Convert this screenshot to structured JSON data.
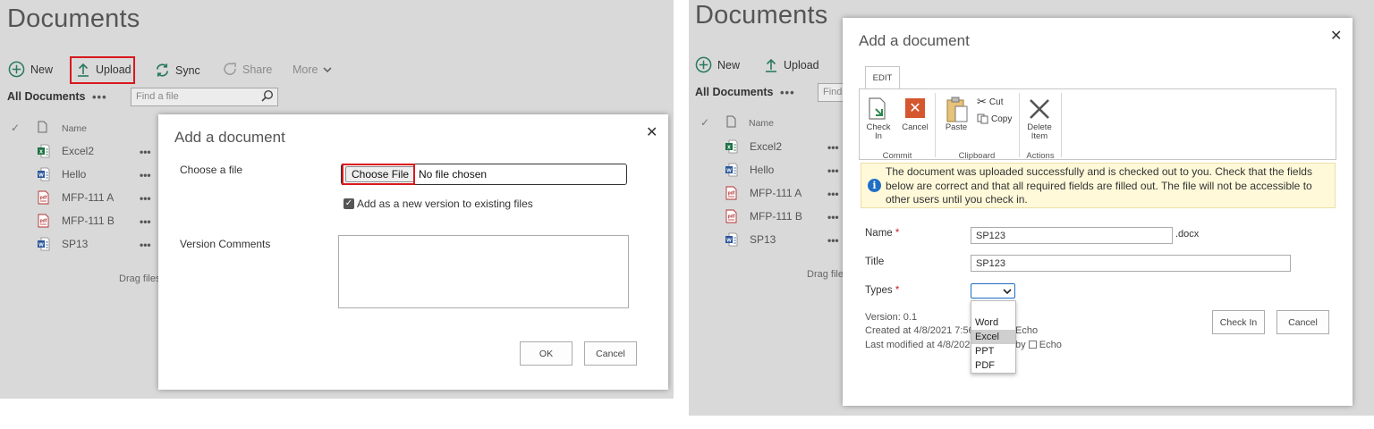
{
  "left": {
    "page_title": "Documents",
    "commands": {
      "new": "New",
      "upload": "Upload",
      "sync": "Sync",
      "share": "Share",
      "more": "More"
    },
    "view_name": "All Documents",
    "view_more": "•••",
    "search_placeholder": "Find a file",
    "column_name": "Name",
    "files": [
      {
        "name": "Excel2",
        "type": "excel"
      },
      {
        "name": "Hello",
        "type": "word"
      },
      {
        "name": "MFP-111 A",
        "type": "pdf"
      },
      {
        "name": "MFP-111 B",
        "type": "pdf"
      },
      {
        "name": "SP13",
        "type": "word"
      }
    ],
    "row_more": "•••",
    "drag_hint": "Drag files",
    "modal": {
      "title": "Add a document",
      "close": "✕",
      "choose_label": "Choose a file",
      "choose_button": "Choose File",
      "no_file": "No file chosen",
      "version_checkbox": "Add as a new version to existing files",
      "version_checked": true,
      "comments_label": "Version Comments",
      "ok": "OK",
      "cancel": "Cancel"
    }
  },
  "right": {
    "page_title": "Documents",
    "commands": {
      "new": "New",
      "upload": "Upload"
    },
    "view_name": "All Documents",
    "view_more": "•••",
    "search_placeholder": "Find",
    "column_name": "Name",
    "files": [
      {
        "name": "Excel2",
        "type": "excel"
      },
      {
        "name": "Hello",
        "type": "word"
      },
      {
        "name": "MFP-111 A",
        "type": "pdf"
      },
      {
        "name": "MFP-111 B",
        "type": "pdf"
      },
      {
        "name": "SP13",
        "type": "word"
      }
    ],
    "row_more": "•••",
    "drag_hint": "Drag file",
    "modal": {
      "title": "Add a document",
      "close": "✕",
      "ribbon_tab": "EDIT",
      "ribbon": {
        "check_in": "Check In",
        "cancel": "Cancel",
        "paste": "Paste",
        "cut": "Cut",
        "copy": "Copy",
        "delete_item": "Delete Item",
        "group_commit": "Commit",
        "group_clipboard": "Clipboard",
        "group_actions": "Actions"
      },
      "notice": "The document was uploaded successfully and is checked out to you. Check that the fields below are correct and that all required fields are filled out. The file will not be accessible to other users until you check in.",
      "name_label": "Name",
      "name_value": "SP123",
      "name_ext": ".docx",
      "title_label": "Title",
      "title_value": "SP123",
      "types_label": "Types",
      "required_mark": "*",
      "types_options": [
        "",
        "Word",
        "Excel",
        "PPT",
        "PDF"
      ],
      "types_highlighted": "Excel",
      "version": "Version: 0.1",
      "created": "Created at 4/8/2021 7:56",
      "created_by": "Echo",
      "modified": "Last modified at 4/8/2021",
      "modified_by_prefix": "by",
      "modified_by": "Echo",
      "check_in_button": "Check In",
      "cancel_button": "Cancel"
    }
  },
  "colors": {
    "panel_bg": "#d9d9d9",
    "highlight_red": "#d9181e",
    "link_blue": "#1f6fc4",
    "notice_bg": "#fff9d9"
  }
}
